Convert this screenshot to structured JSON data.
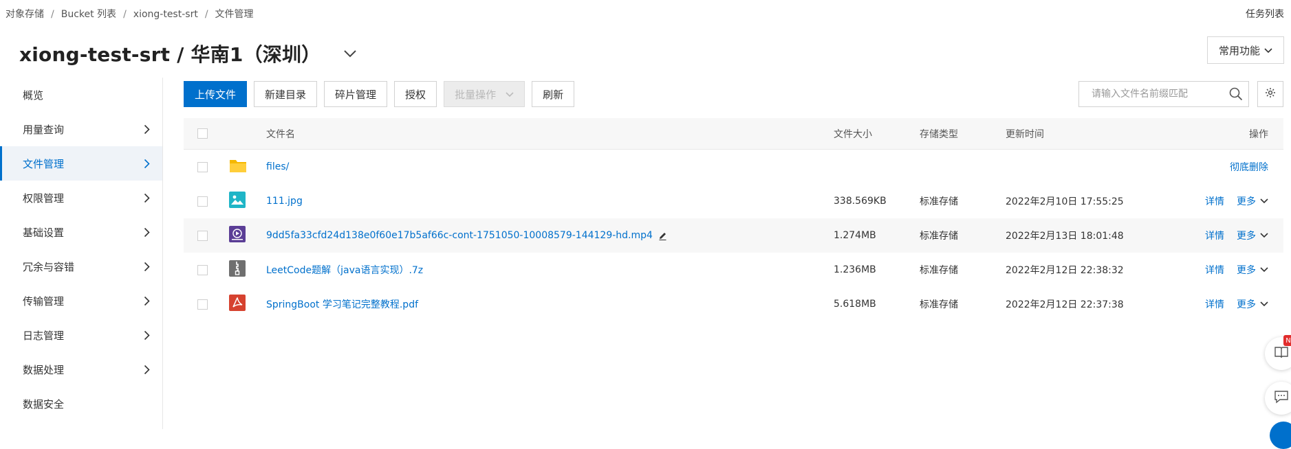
{
  "breadcrumb": [
    "对象存储",
    "Bucket 列表",
    "xiong-test-srt",
    "文件管理"
  ],
  "breadcrumb_sep": "/",
  "task_list": "任务列表",
  "page_title": "xiong-test-srt / 华南1（深圳）",
  "common_functions": "常用功能",
  "sidebar": [
    {
      "label": "概览",
      "chevron": false,
      "active": false
    },
    {
      "label": "用量查询",
      "chevron": true,
      "active": false
    },
    {
      "label": "文件管理",
      "chevron": true,
      "active": true
    },
    {
      "label": "权限管理",
      "chevron": true,
      "active": false
    },
    {
      "label": "基础设置",
      "chevron": true,
      "active": false
    },
    {
      "label": "冗余与容错",
      "chevron": true,
      "active": false
    },
    {
      "label": "传输管理",
      "chevron": true,
      "active": false
    },
    {
      "label": "日志管理",
      "chevron": true,
      "active": false
    },
    {
      "label": "数据处理",
      "chevron": true,
      "active": false
    },
    {
      "label": "数据安全",
      "chevron": false,
      "active": false
    }
  ],
  "toolbar": {
    "upload": "上传文件",
    "new_dir": "新建目录",
    "fragments": "碎片管理",
    "authorize": "授权",
    "batch": "批量操作",
    "refresh": "刷新"
  },
  "search": {
    "placeholder": "请输入文件名前缀匹配"
  },
  "table": {
    "columns": {
      "name": "文件名",
      "size": "文件大小",
      "type": "存储类型",
      "time": "更新时间",
      "op": "操作"
    },
    "rows": [
      {
        "icon": "folder",
        "name": "files/",
        "size": "",
        "type": "",
        "time": "",
        "ops": [
          "彻底删除"
        ],
        "edit": false
      },
      {
        "icon": "image",
        "name": "111.jpg",
        "size": "338.569KB",
        "type": "标准存储",
        "time": "2022年2月10日 17:55:25",
        "ops": [
          "详情",
          "更多"
        ],
        "edit": false
      },
      {
        "icon": "video",
        "name": "9dd5fa33cfd24d138e0f60e17b5af66c-cont-1751050-10008579-144129-hd.mp4",
        "size": "1.274MB",
        "type": "标准存储",
        "time": "2022年2月13日 18:01:48",
        "ops": [
          "详情",
          "更多"
        ],
        "edit": true
      },
      {
        "icon": "archive",
        "name": "LeetCode题解（java语言实现）.7z",
        "size": "1.236MB",
        "type": "标准存储",
        "time": "2022年2月12日 22:38:32",
        "ops": [
          "详情",
          "更多"
        ],
        "edit": false
      },
      {
        "icon": "pdf",
        "name": "SpringBoot 学习笔记完整教程.pdf",
        "size": "5.618MB",
        "type": "标准存储",
        "time": "2022年2月12日 22:37:38",
        "ops": [
          "详情",
          "更多"
        ],
        "edit": false
      }
    ]
  },
  "float_badge": "N",
  "colors": {
    "accent": "#0070cc",
    "folder": "#f5b800",
    "image": "#1fb5c7",
    "video": "#5b3e96",
    "archive": "#6f6f6f",
    "pdf": "#d6422f"
  }
}
